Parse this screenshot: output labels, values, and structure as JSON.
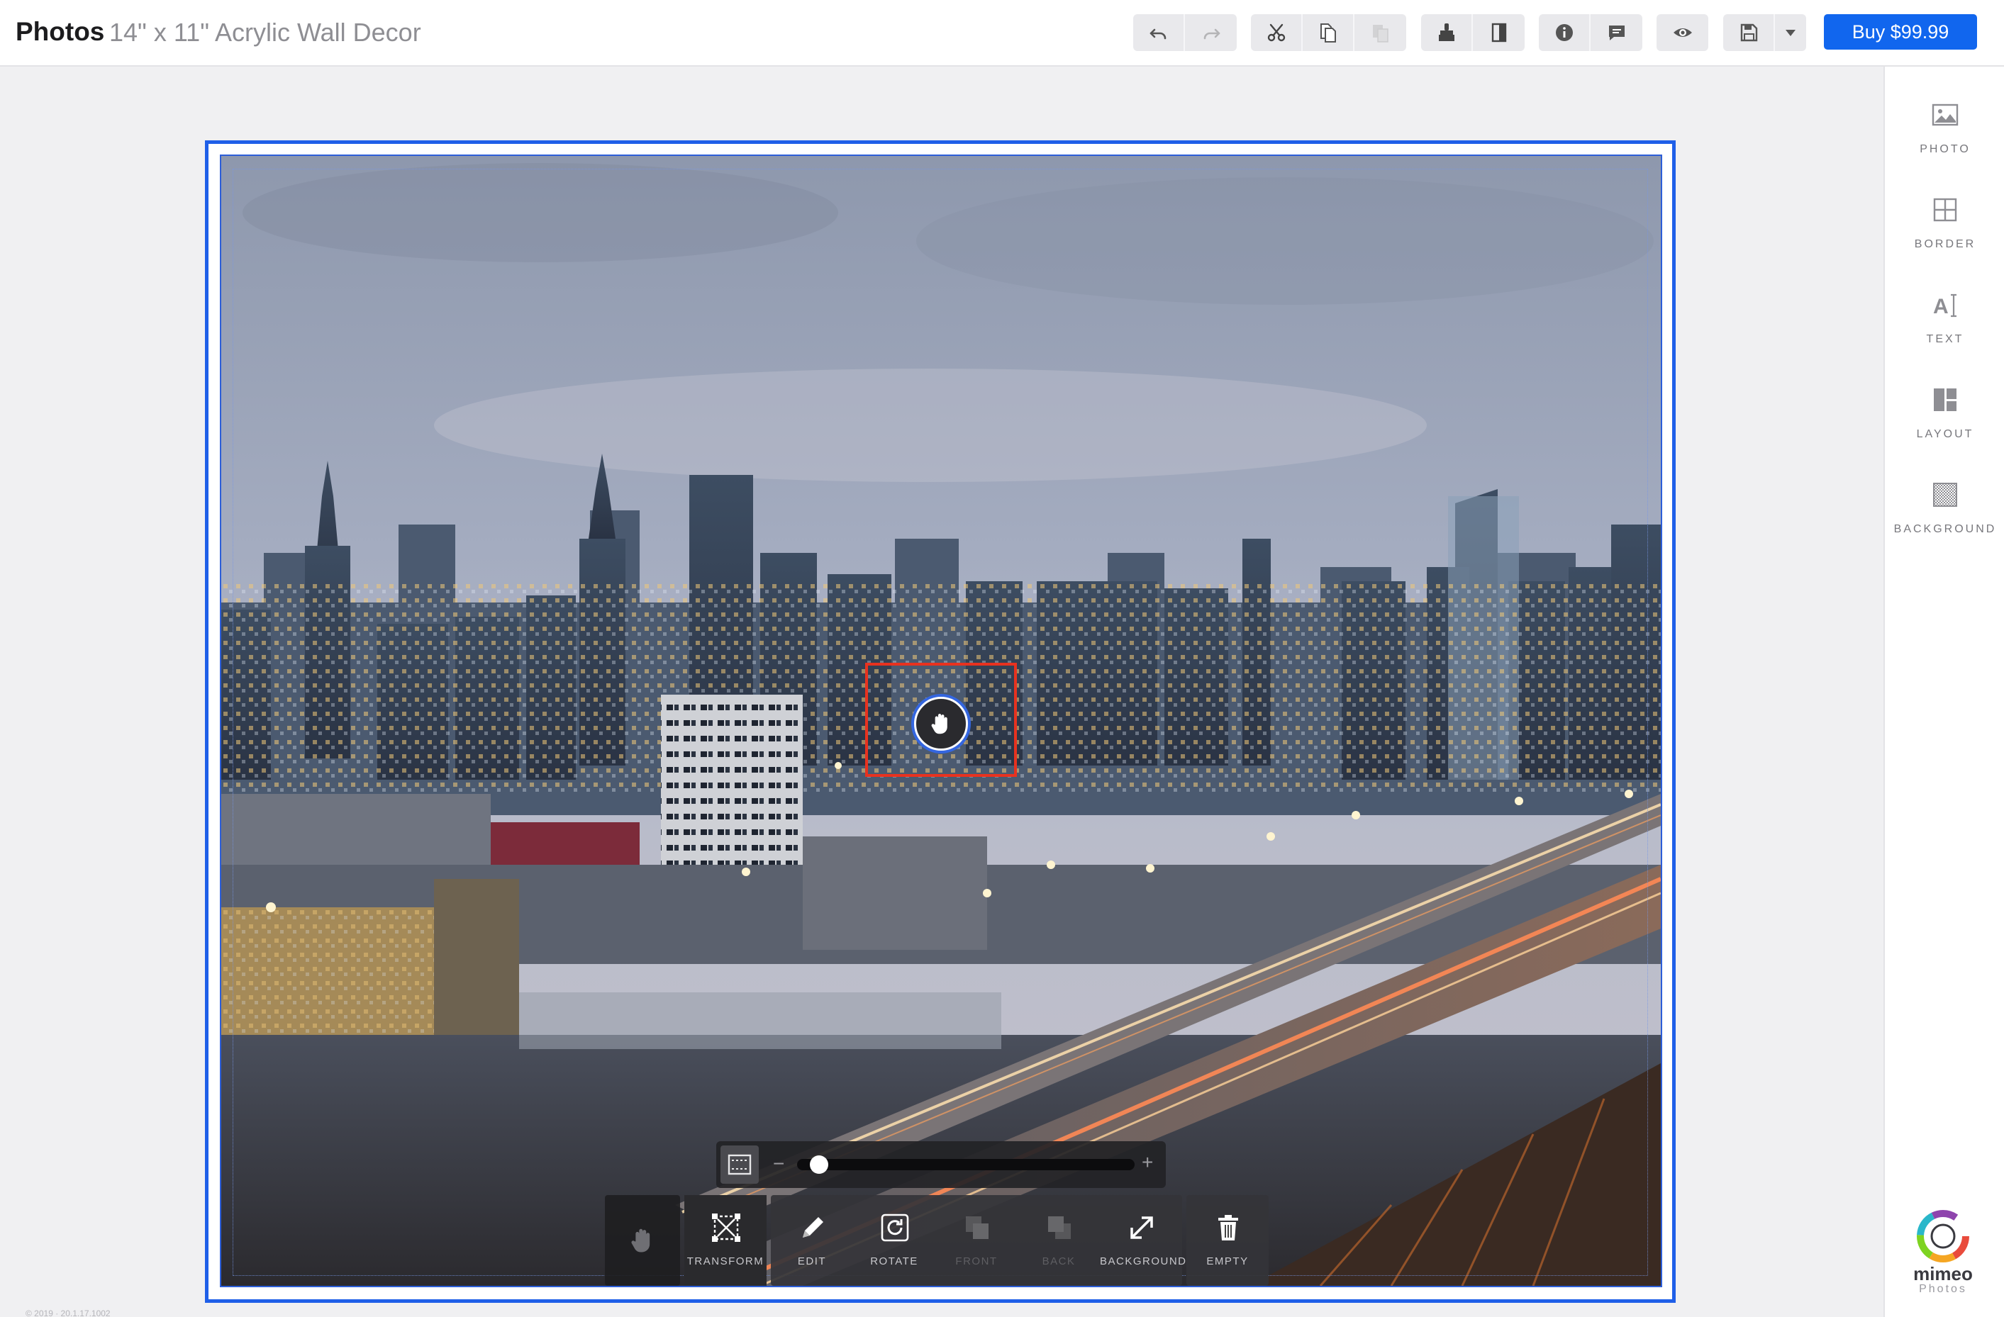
{
  "header": {
    "app_name": "Photos",
    "doc_title": "14\" x 11\" Acrylic Wall Decor",
    "buy_label": "Buy $99.99",
    "accent_color": "#1166ee"
  },
  "toolbar_icons": [
    "undo-icon",
    "redo-icon",
    "scissors-icon",
    "copy-icon",
    "paste-icon",
    "paint-brush-icon",
    "page-icon",
    "info-icon",
    "comment-icon",
    "eye-icon",
    "save-icon",
    "caret-down-icon"
  ],
  "sidebar": {
    "items": [
      {
        "label": "PHOTO",
        "icon": "photo-icon"
      },
      {
        "label": "BORDER",
        "icon": "border-icon"
      },
      {
        "label": "TEXT",
        "icon": "text-icon"
      },
      {
        "label": "LAYOUT",
        "icon": "layout-icon"
      },
      {
        "label": "BACKGROUND",
        "icon": "background-icon"
      }
    ]
  },
  "brand": {
    "word": "mimeo",
    "sub": "Photos"
  },
  "zoom": {
    "minus": "−",
    "plus": "+",
    "level": 0.04
  },
  "tools": {
    "hand": "hand-icon",
    "items": [
      {
        "label": "TRANSFORM",
        "icon": "transform-icon",
        "enabled": true
      },
      {
        "label": "EDIT",
        "icon": "pencil-icon",
        "enabled": true
      },
      {
        "label": "ROTATE",
        "icon": "rotate-icon",
        "enabled": true
      },
      {
        "label": "FRONT",
        "icon": "bring-front-icon",
        "enabled": false
      },
      {
        "label": "BACK",
        "icon": "send-back-icon",
        "enabled": false
      },
      {
        "label": "BACKGROUND",
        "icon": "expand-icon",
        "enabled": true
      },
      {
        "label": "EMPTY",
        "icon": "trash-icon",
        "enabled": true
      }
    ]
  },
  "footer": {
    "version": "© 2019 · 20.1.17.1002"
  }
}
